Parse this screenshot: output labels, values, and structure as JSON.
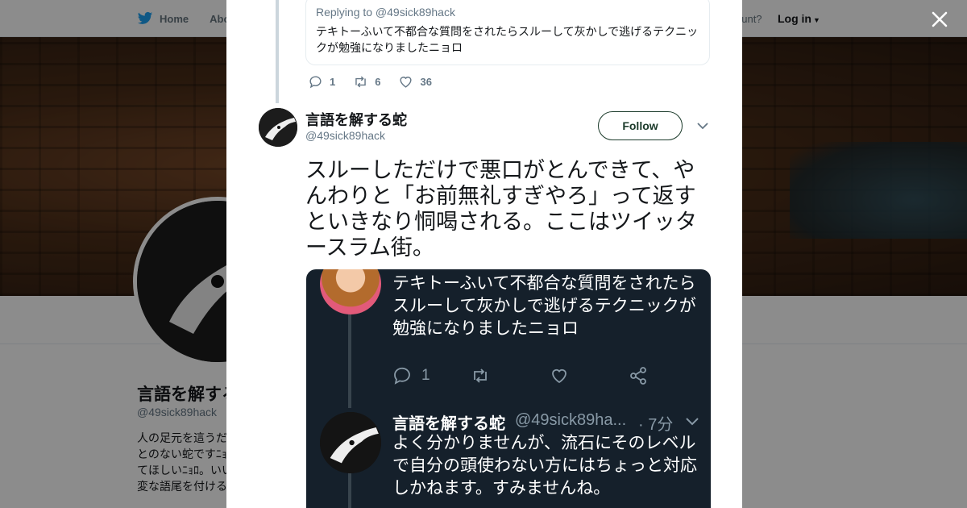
{
  "background": {
    "nav": {
      "home_label": "Home",
      "about_label": "Abo"
    },
    "account_text": "ccount?",
    "login_label": "Log in",
    "profile": {
      "name": "言語を解する",
      "handle": "@49sick89hack",
      "bio_lines": [
        "人の足元を這うだ",
        "とのない蛇ですﾆｮ",
        "てほしいﾆｮﾛ。いい",
        "変な語尾を付ける"
      ]
    }
  },
  "modal": {
    "quoted": {
      "replying_to": "Replying to @49sick89hack",
      "text": "テキトーふいて不都合な質問をされたらスルーして灰かしで逃げるテクニックが勉強になりましたニョロ"
    },
    "actions": {
      "replies": "1",
      "retweets": "6",
      "likes": "36"
    },
    "tweet": {
      "author_name": "言語を解する蛇",
      "author_handle": "@49sick89hack",
      "follow_label": "Follow",
      "text": "スルーしただけで悪口がとんできて、やんわりと「お前無礼すぎやろ」って返すといきなり恫喝される。ここはツイッタースラム街。"
    },
    "media": {
      "tweet1_text": "テキトーふいて不都合な質問をされたらスルーして灰かしで逃げるテクニックが勉強になりましたニョロ",
      "tweet1_replies": "1",
      "tweet2_name": "言語を解する蛇",
      "tweet2_handle": "@49sick89ha...",
      "tweet2_time": "· 7分",
      "tweet2_text": "よく分かりませんが、流石にそのレベルで自分の頭使わない方にはちょっと対応しかねます。すみませんね。"
    }
  },
  "colors": {
    "twitter_blue": "#1da1f2",
    "follow_green": "#1b3a2a",
    "dark_bg": "#15202b"
  },
  "icons": [
    "twitter-bird-icon",
    "close-icon",
    "reply-icon",
    "retweet-icon",
    "like-icon",
    "share-icon",
    "chevron-down-icon"
  ]
}
